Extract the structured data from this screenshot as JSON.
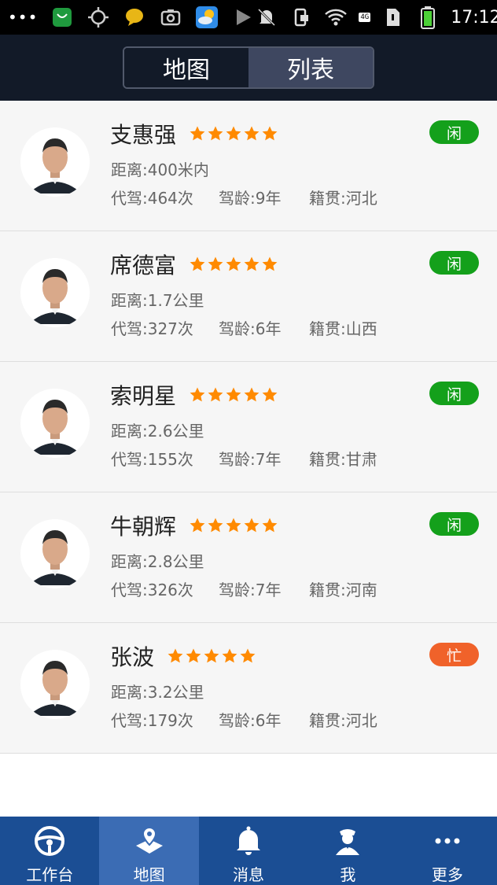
{
  "status_bar": {
    "time": "17:12",
    "network": "4G"
  },
  "header": {
    "tabs": [
      {
        "label": "地图",
        "active": false
      },
      {
        "label": "列表",
        "active": true
      }
    ]
  },
  "drivers": [
    {
      "name": "支惠强",
      "rating": 5,
      "distance": "距离:400米内",
      "trips": "代驾:464次",
      "experience": "驾龄:9年",
      "hometown": "籍贯:河北",
      "status": "闲",
      "status_color": "#14a01b"
    },
    {
      "name": "席德富",
      "rating": 5,
      "distance": "距离:1.7公里",
      "trips": "代驾:327次",
      "experience": "驾龄:6年",
      "hometown": "籍贯:山西",
      "status": "闲",
      "status_color": "#14a01b"
    },
    {
      "name": "索明星",
      "rating": 5,
      "distance": "距离:2.6公里",
      "trips": "代驾:155次",
      "experience": "驾龄:7年",
      "hometown": "籍贯:甘肃",
      "status": "闲",
      "status_color": "#14a01b"
    },
    {
      "name": "牛朝辉",
      "rating": 5,
      "distance": "距离:2.8公里",
      "trips": "代驾:326次",
      "experience": "驾龄:7年",
      "hometown": "籍贯:河南",
      "status": "闲",
      "status_color": "#14a01b"
    },
    {
      "name": "张波",
      "rating": 5,
      "distance": "距离:3.2公里",
      "trips": "代驾:179次",
      "experience": "驾龄:6年",
      "hometown": "籍贯:河北",
      "status": "忙",
      "status_color": "#f0622a"
    }
  ],
  "bottom_nav": [
    {
      "label": "工作台",
      "icon": "steering-wheel-icon",
      "active": false
    },
    {
      "label": "地图",
      "icon": "map-pin-icon",
      "active": true
    },
    {
      "label": "消息",
      "icon": "bell-icon",
      "active": false
    },
    {
      "label": "我",
      "icon": "driver-icon",
      "active": false
    },
    {
      "label": "更多",
      "icon": "more-icon",
      "active": false
    }
  ],
  "colors": {
    "header_bg": "#121a28",
    "star": "#ff8a00",
    "free": "#14a01b",
    "busy": "#f0622a",
    "nav_bg": "#1b4e94",
    "nav_active": "#3b6cb4"
  }
}
